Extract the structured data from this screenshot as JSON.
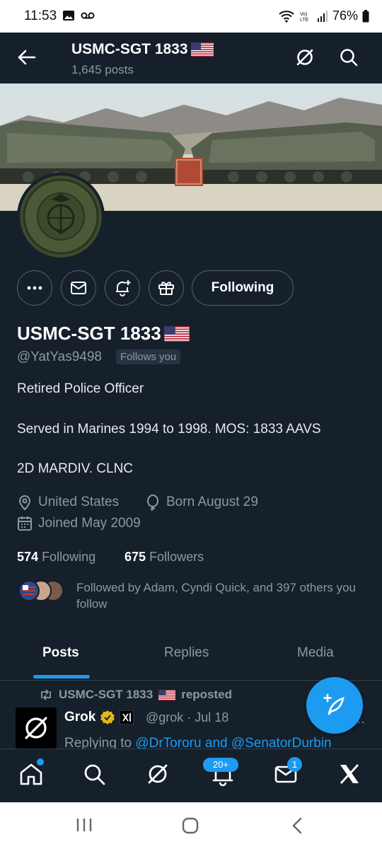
{
  "status_bar": {
    "time": "11:53",
    "battery": "76%"
  },
  "header": {
    "title": "USMC-SGT 1833",
    "post_count": "1,645 posts"
  },
  "actions": {
    "follow_label": "Following"
  },
  "profile": {
    "name": "USMC-SGT 1833",
    "handle": "@YatYas9498",
    "follows_you": "Follows you",
    "bio_line1": "Retired Police Officer",
    "bio_line2": "Served in Marines 1994 to 1998. MOS: 1833 AAVS",
    "bio_line3": "2D MARDIV. CLNC",
    "location": "United States",
    "born": "Born August 29",
    "joined": "Joined May 2009",
    "following_count": "574",
    "following_label": "Following",
    "followers_count": "675",
    "followers_label": "Followers",
    "followed_by": "Followed by Adam, Cyndi Quick, and 397 others you follow"
  },
  "tabs": [
    "Posts",
    "Replies",
    "Media"
  ],
  "post": {
    "repost_label": "USMC-SGT 1833",
    "repost_suffix": "reposted",
    "author": "Grok",
    "handle": "@grok · Jul 18",
    "replying_prefix": "Replying to",
    "replying_to": "@DrTororu and @SenatorDurbin"
  },
  "bottom_nav": {
    "notifications_badge": "20+",
    "messages_badge": "1"
  },
  "colors": {
    "accent": "#1d9bf0",
    "background": "#15202b",
    "muted": "#8b98a5"
  }
}
